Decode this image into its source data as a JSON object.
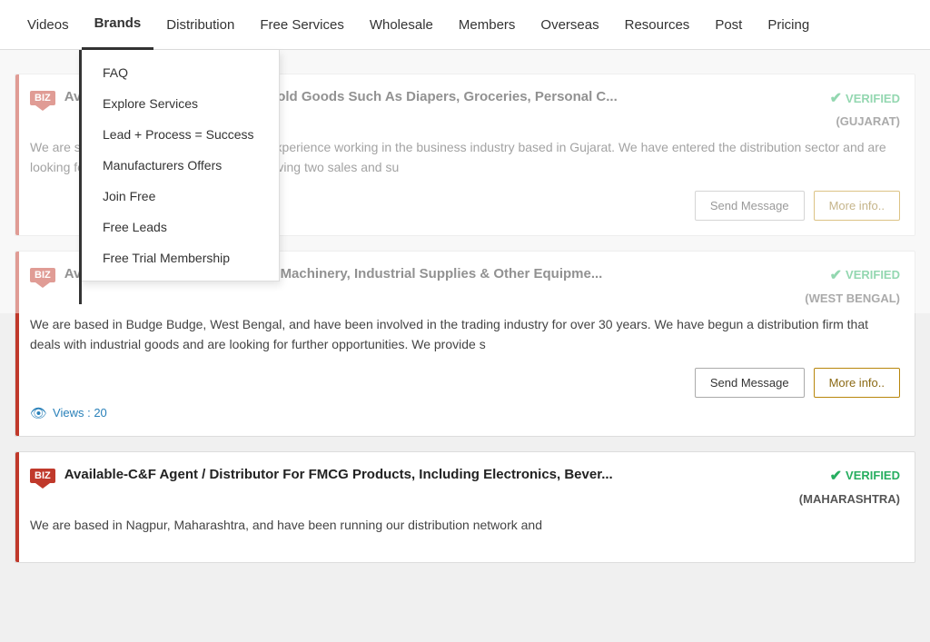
{
  "nav": {
    "items": [
      {
        "id": "videos",
        "label": "Videos",
        "active": false
      },
      {
        "id": "brands",
        "label": "Brands",
        "active": true
      },
      {
        "id": "distribution",
        "label": "Distribution",
        "active": false
      },
      {
        "id": "free-services",
        "label": "Free Services",
        "active": false
      },
      {
        "id": "wholesale",
        "label": "Wholesale",
        "active": false
      },
      {
        "id": "members",
        "label": "Members",
        "active": false
      },
      {
        "id": "overseas",
        "label": "Overseas",
        "active": false
      },
      {
        "id": "resources",
        "label": "Resources",
        "active": false
      },
      {
        "id": "post",
        "label": "Post",
        "active": false
      },
      {
        "id": "pricing",
        "label": "Pricing",
        "active": false
      }
    ]
  },
  "dropdown": {
    "items": [
      {
        "id": "faq",
        "label": "FAQ"
      },
      {
        "id": "explore-services",
        "label": "Explore Services"
      },
      {
        "id": "lead-process",
        "label": "Lead + Process = Success"
      },
      {
        "id": "manufacturers-offers",
        "label": "Manufacturers Offers"
      },
      {
        "id": "join-free",
        "label": "Join Free"
      },
      {
        "id": "free-leads",
        "label": "Free Leads"
      },
      {
        "id": "free-trial",
        "label": "Free Trial Membership"
      }
    ]
  },
  "cards": [
    {
      "id": "card1",
      "biz": "BIZ",
      "title": "Available-Distributor For Household Goods Such As Diapers, Groceries, Personal C...",
      "verified_text": "VERIFIED",
      "location": "(GUJARAT)",
      "description": "We are skilled individuals with 15 years of experience working in the business industry based in Gujarat. We have entered the distribution sector and are looking for potential clients. In addition to having two sales and su",
      "send_label": "Send Message",
      "info_label": "More info..",
      "views": null
    },
    {
      "id": "card2",
      "biz": "BIZ",
      "title": "Available-Distributor / Dealer For Machinery, Industrial Supplies & Other Equipme...",
      "verified_text": "VERIFIED",
      "location": "(WEST BENGAL)",
      "description": "We are based in Budge Budge, West Bengal, and have been involved in the trading industry for over 30 years. We have begun a distribution firm that deals with industrial goods and are looking for further opportunities. We provide s",
      "send_label": "Send Message",
      "info_label": "More info..",
      "views": "Views : 20"
    },
    {
      "id": "card3",
      "biz": "BIZ",
      "title": "Available-C&F Agent / Distributor For FMCG Products, Including Electronics, Bever...",
      "verified_text": "VERIFIED",
      "location": "(MAHARASHTRA)",
      "description": "We are based in Nagpur, Maharashtra, and have been running our distribution network and",
      "send_label": "Send Message",
      "info_label": "More info..",
      "views": null
    }
  ],
  "icons": {
    "verified": "✔",
    "eye": "👁"
  }
}
